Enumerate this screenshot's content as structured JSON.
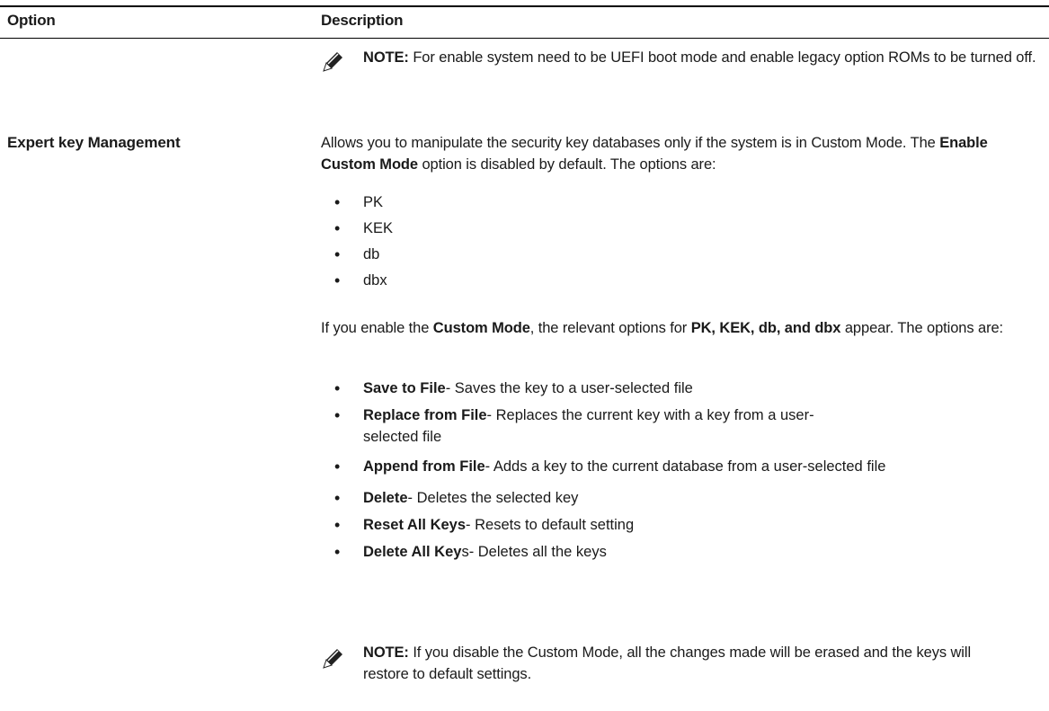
{
  "table": {
    "header": {
      "option": "Option",
      "description": "Description"
    }
  },
  "note1": {
    "label": "NOTE:",
    "text": "For enable system need to be UEFI boot mode and enable legacy option ROMs to be turned off."
  },
  "row": {
    "option": "Expert key Management",
    "intro_a": "Allows you to manipulate the security key databases only if the system is in Custom Mode. The ",
    "intro_b": "Enable Custom Mode",
    "intro_c": " option is disabled by default. The options are:",
    "keys": [
      "PK",
      "KEK",
      "db",
      "dbx"
    ],
    "custom_a": "If you enable the ",
    "custom_b": "Custom Mode",
    "custom_c": ", the relevant options for ",
    "custom_d": "PK, KEK, db, and dbx",
    "custom_e": " appear. The options are:",
    "actions": [
      {
        "name": "Save to File",
        "desc": "- Saves the key to a user-selected file"
      },
      {
        "name": "Replace from File",
        "desc": "- Replaces the current key with a key from a user-selected file"
      },
      {
        "name": "Append from File",
        "desc": "- Adds a key to the current database from a user-selected file"
      },
      {
        "name": "Delete",
        "desc": "- Deletes the selected key"
      },
      {
        "name": "Reset All Keys",
        "desc": "- Resets to default setting"
      },
      {
        "name": "Delete All Key",
        "desc": "s- Deletes all the keys"
      }
    ]
  },
  "note2": {
    "label": "NOTE:",
    "text": "If you disable the Custom Mode, all the changes made will be erased and the keys will restore to default settings."
  },
  "icons": {
    "note": "note-pencil-icon"
  }
}
